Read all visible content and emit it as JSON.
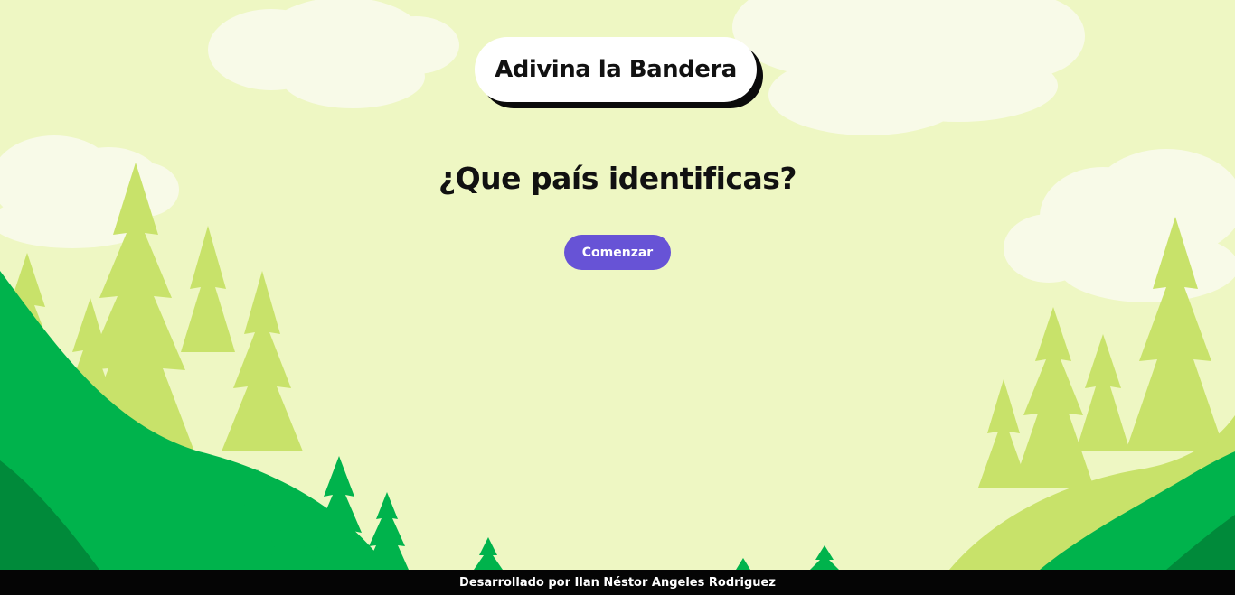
{
  "header": {
    "title": "Adivina la Bandera"
  },
  "main": {
    "question": "¿Que país identificas?",
    "start_button_label": "Comenzar"
  },
  "footer": {
    "credit": "Desarrollado por Ilan Néstor Angeles Rodriguez"
  },
  "colors": {
    "background": "#eef7c3",
    "button": "#6753d6",
    "footer": "#050505",
    "hill_dark": "#008a3a",
    "hill": "#00b34c",
    "tree_light": "#c8e26a",
    "cloud": "#f8fae8"
  }
}
